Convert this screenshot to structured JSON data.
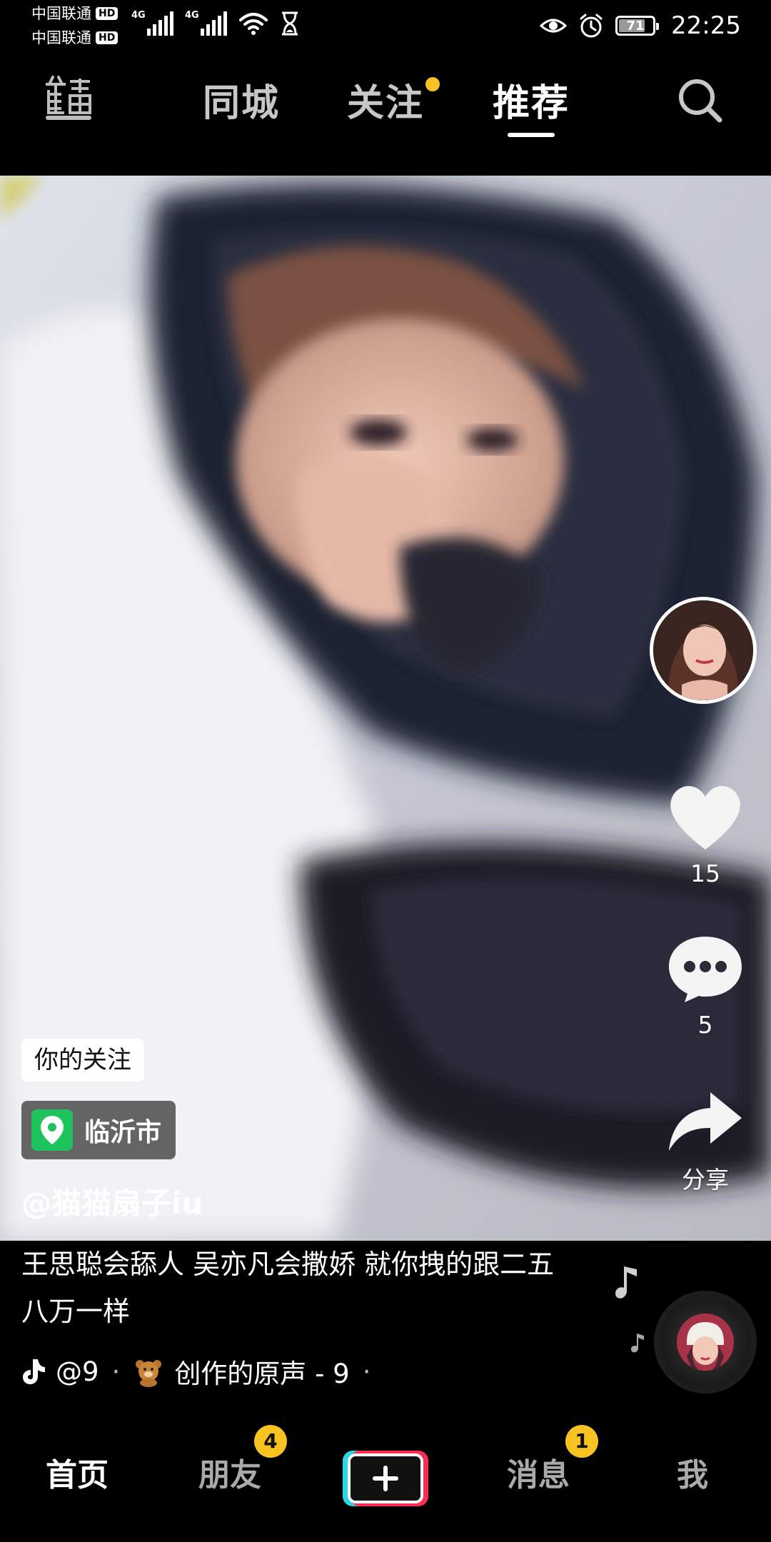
{
  "status_bar": {
    "carrier_1": "中国联通",
    "carrier_2": "中国联通",
    "hd_label": "HD",
    "network_1": "4G",
    "network_2": "4G",
    "battery": "71",
    "time": "22:25",
    "icons": [
      "signal-icon",
      "wifi-icon",
      "hourglass-icon",
      "eye-icon",
      "alarm-icon",
      "battery-icon"
    ]
  },
  "top_nav": {
    "live_icon": "live-icon",
    "tabs": [
      {
        "label": "同城"
      },
      {
        "label": "关注"
      },
      {
        "label": "推荐"
      }
    ],
    "active_tab": "推荐",
    "follow_dot_color": "#f8c320",
    "search_icon": "search-icon"
  },
  "video": {
    "creator_avatar": "avatar",
    "actions": {
      "like_count": "15",
      "comment_count": "5",
      "share_label": "分享"
    },
    "follow_tag": "你的关注",
    "location": "临沂市",
    "author": "@猫猫扇子iu",
    "caption": "王思聪会舔人 吴亦凡会撒娇 就你拽的跟二五八万一样",
    "music": {
      "by": "@9",
      "separator": "·",
      "title": "创作的原声 - 9",
      "trailing": "·"
    }
  },
  "bottom_bar": {
    "tabs": [
      {
        "label": "首页"
      },
      {
        "label": "朋友"
      },
      {
        "label": "消息"
      },
      {
        "label": "我"
      }
    ],
    "friends_badge": "4",
    "messages_badge": "1",
    "badge_color": "#f8c320",
    "plus_icon": "plus-icon"
  }
}
